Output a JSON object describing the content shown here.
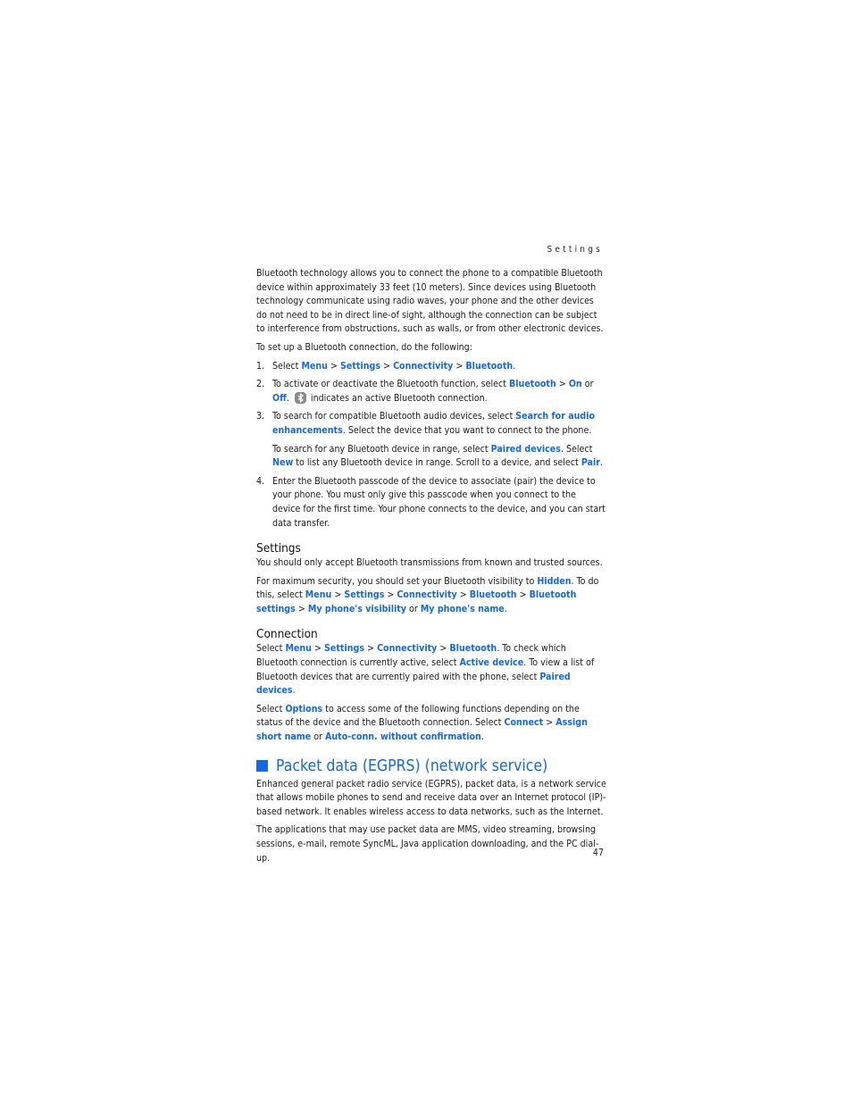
{
  "header": {
    "running_title": "Settings"
  },
  "intro": {
    "paragraph": "Bluetooth technology allows you to connect the phone to a compatible Bluetooth device within approximately 33 feet (10 meters). Since devices using Bluetooth technology communicate using radio waves, your phone and the other devices do not need to be in direct line-of sight, although the connection can be subject to interference from obstructions, such as walls, or from other electronic devices.",
    "setup_lead": "To set up a Bluetooth connection, do the following:"
  },
  "steps": [
    {
      "num": "1.",
      "t1": "Select ",
      "k1": "Menu",
      "s1": " > ",
      "k2": "Settings",
      "s2": " > ",
      "k3": "Connectivity",
      "s3": " > ",
      "k4": "Bluetooth",
      "end": "."
    },
    {
      "num": "2.",
      "t1": "To activate or deactivate the Bluetooth function, select ",
      "k1": "Bluetooth",
      "s1": " > ",
      "k2": "On",
      "s2": " or ",
      "k3": "Off",
      "s3": ".",
      "icon": "bluetooth-active-icon",
      "t2": " indicates an active Bluetooth connection."
    },
    {
      "num": "3.",
      "t1": "To search for compatible Bluetooth audio devices, select ",
      "k1": "Search for audio enhancements",
      "t2": ". Select the device that you want to connect to the phone.",
      "sub_t1": "To search for any Bluetooth device in range, select ",
      "sub_k1": "Paired devices",
      "sub_t2": ". Select ",
      "sub_k2": "New",
      "sub_t3": " to list any Bluetooth device in range. Scroll to a device, and select ",
      "sub_k3": "Pair",
      "sub_t4": "."
    },
    {
      "num": "4.",
      "t1": "Enter the Bluetooth passcode of the device to associate (pair) the device to your phone. You must only give this passcode when you connect to the device for the first time. Your phone connects to the device, and you can start data transfer."
    }
  ],
  "settings_section": {
    "heading": "Settings",
    "p1": "You should only accept Bluetooth transmissions from known and trusted sources.",
    "p2_t1": "For maximum security, you should set your Bluetooth visibility to ",
    "p2_k1": "Hidden",
    "p2_t2": ". To do this, select ",
    "p2_k2": "Menu",
    "p2_k3": "Settings",
    "p2_k4": "Connectivity",
    "p2_k5": "Bluetooth",
    "p2_k6": "Bluetooth settings",
    "p2_k7": "My phone's visibility",
    "p2_or": " or ",
    "p2_k8": "My phone's name",
    "sep": " > ",
    "end": "."
  },
  "connection_section": {
    "heading": "Connection",
    "p1_t1": "Select ",
    "p1_k1": "Menu",
    "p1_k2": "Settings",
    "p1_k3": "Connectivity",
    "p1_k4": "Bluetooth",
    "p1_t2": ". To check which Bluetooth connection is currently active, select ",
    "p1_k5": "Active device",
    "p1_t3": ". To view a list of Bluetooth devices that are currently paired with the phone, select ",
    "p1_k6": "Paired devices",
    "p2_t1": "Select ",
    "p2_k1": "Options",
    "p2_t2": " to access some of the following functions depending on the status of the device and the Bluetooth connection. Select ",
    "p2_k2": "Connect",
    "p2_k3": "Assign short name",
    "p2_or": " or ",
    "p2_k4": "Auto-conn. without confirmation",
    "sep": " > ",
    "end": "."
  },
  "packet_section": {
    "heading": "Packet data (EGPRS) (network service)",
    "p1": "Enhanced general packet radio service (EGPRS), packet data, is a network service that allows mobile phones to send and receive data over an Internet protocol (IP)-based network. It enables wireless access to data networks, such as the Internet.",
    "p2": "The applications that may use packet data are MMS, video streaming, browsing sessions, e-mail, remote SyncML, Java application downloading, and the PC dial-up."
  },
  "footer": {
    "page_number": "47"
  },
  "colors": {
    "accent": "#1168e8",
    "text": "#1a1a1a"
  }
}
